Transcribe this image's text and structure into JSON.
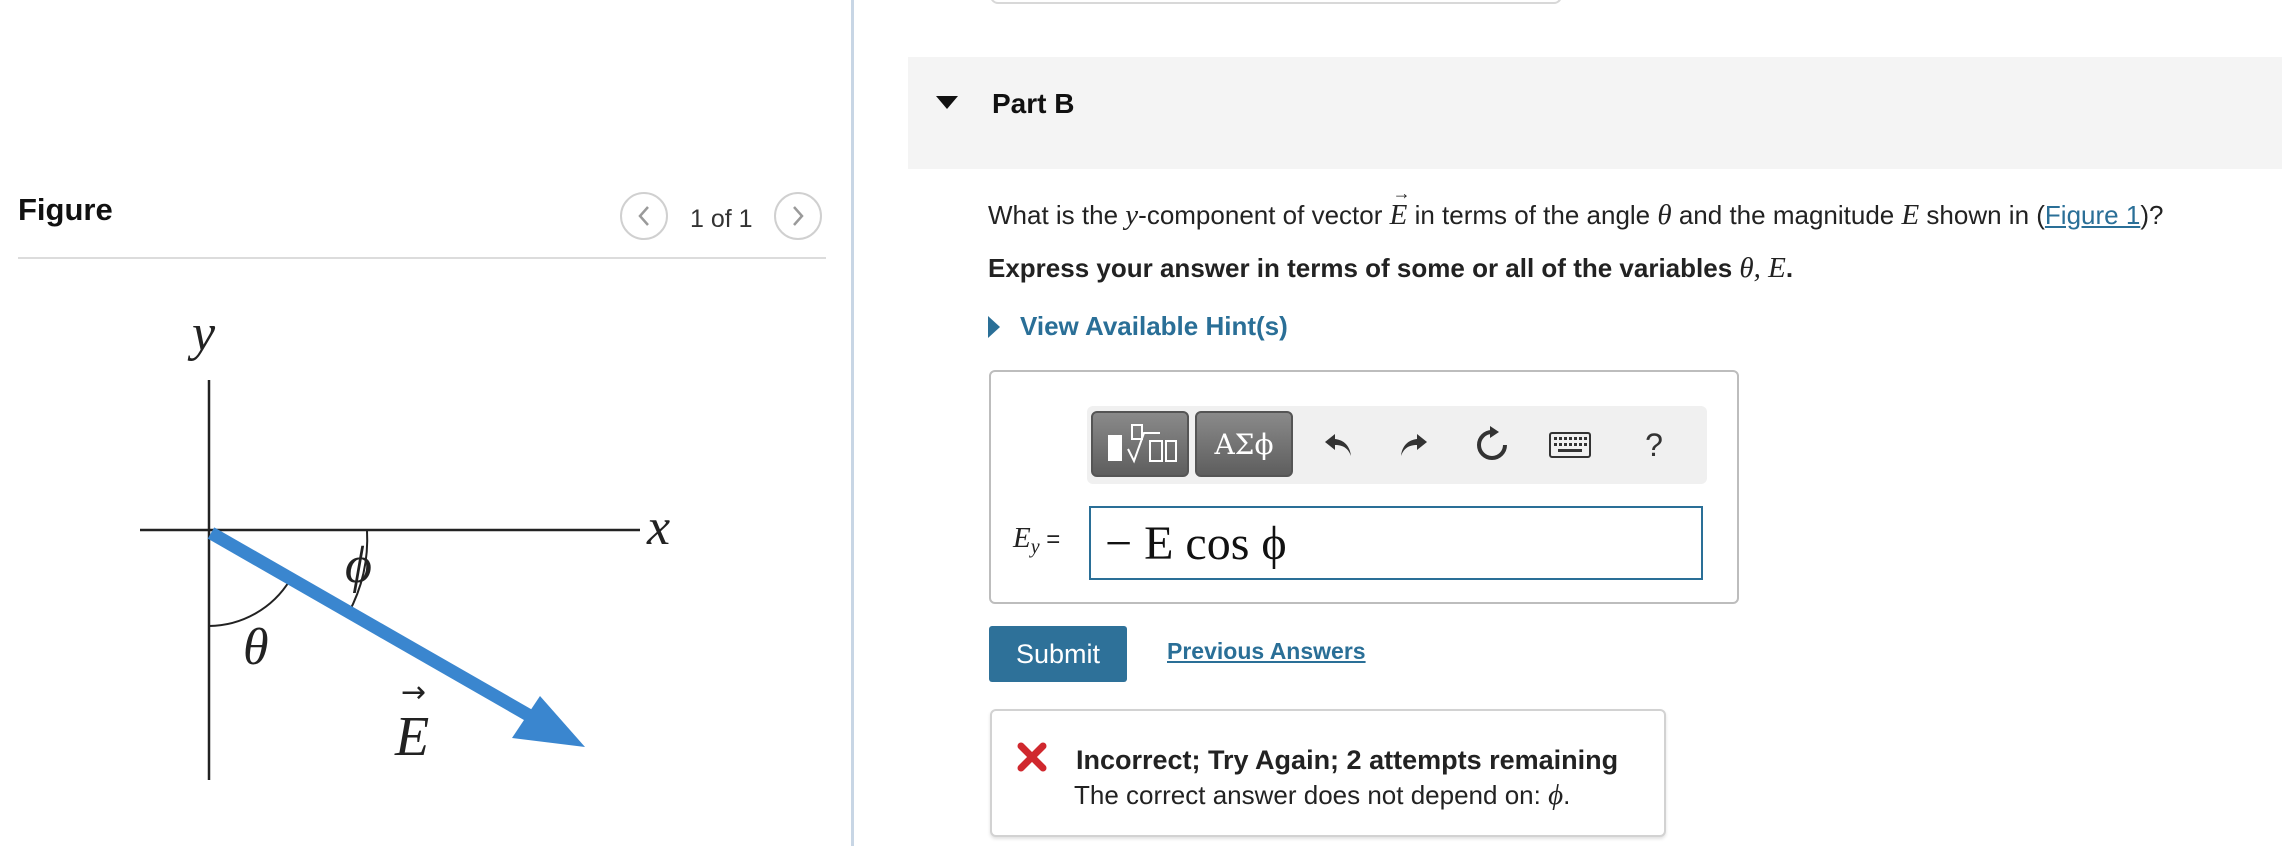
{
  "figure_panel": {
    "title": "Figure",
    "counter": "1 of 1",
    "diagram_labels": {
      "y_axis": "y",
      "x_axis": "x",
      "phi": "ϕ",
      "theta": "θ",
      "vector": "E"
    },
    "arrow_color": "#3a86cf"
  },
  "part": {
    "title": "Part B"
  },
  "question": {
    "text_1": "What is the ",
    "var_y": "y",
    "text_2": "-component of vector ",
    "var_E_vec": "E",
    "text_3": " in terms of the angle ",
    "var_theta": "θ",
    "text_4": " and the magnitude ",
    "var_E": "E",
    "text_5": " shown in (",
    "figure_link": "Figure 1",
    "text_6": ")?"
  },
  "instruction": {
    "text": "Express your answer in terms of some or all of the variables ",
    "vars": "θ, E",
    "end": "."
  },
  "hint": {
    "label": "View Available Hint(s)"
  },
  "toolbar": {
    "symbols_label": "ΑΣϕ",
    "help_label": "?",
    "icons": [
      "templates-icon",
      "undo-icon",
      "redo-icon",
      "reset-icon",
      "keyboard-icon"
    ]
  },
  "answer": {
    "label_var": "E",
    "label_sub": "y",
    "label_eq": " =",
    "value": "− E cos ϕ"
  },
  "actions": {
    "submit_label": "Submit",
    "previous_answers_label": "Previous Answers"
  },
  "feedback": {
    "title": "Incorrect; Try Again; 2 attempts remaining",
    "detail_text": "The correct answer does not depend on: ",
    "detail_var": "ϕ",
    "detail_end": ".",
    "status_color": "#d0282e"
  },
  "colors": {
    "accent": "#2a6f97",
    "submit_bg": "#2e7199"
  }
}
